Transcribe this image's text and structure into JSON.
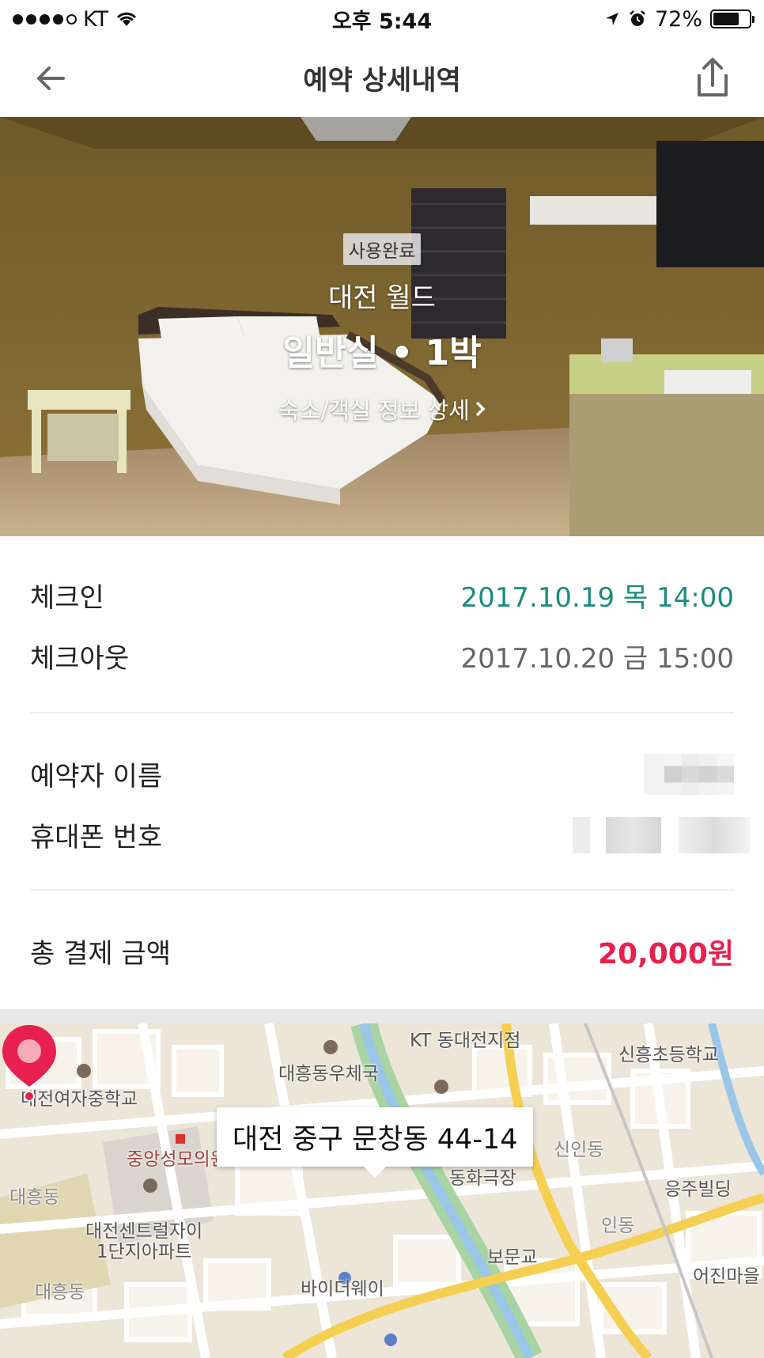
{
  "status_bar": {
    "carrier": "KT",
    "time": "오후 5:44",
    "battery": "72%",
    "battery_level": 0.72
  },
  "nav": {
    "title": "예약 상세내역"
  },
  "hero": {
    "badge": "사용완료",
    "hotel_name": "대전 월드",
    "room_info": "일반실 • 1박",
    "detail_link": "숙소/객실 정보 상세"
  },
  "stay": {
    "checkin_label": "체크인",
    "checkin_value": "2017.10.19 목 14:00",
    "checkout_label": "체크아웃",
    "checkout_value": "2017.10.20 금 15:00"
  },
  "guest": {
    "name_label": "예약자 이름",
    "phone_label": "휴대폰 번호"
  },
  "payment": {
    "total_label": "총 결제 금액",
    "total_value": "20,000원"
  },
  "map": {
    "address": "대전 중구 문창동 44-14",
    "labels": {
      "kt": "KT 동대전지점",
      "school1": "신흥초등학교",
      "post": "대흥동우체국",
      "school2": "대전여자중학교",
      "church": "중앙성모의원",
      "shinin": "신인동",
      "daeheung": "대흥동",
      "theater": "동화극장",
      "eungju": "응주빌딩",
      "apt": "대전센트럴자이\n1단지아파트",
      "indong": "인동",
      "bomun": "보문교",
      "daeheung2": "대흥동",
      "buyer": "바이더웨이",
      "eojin": "어진마을"
    }
  },
  "colors": {
    "teal": "#1b8c7d",
    "accent_red": "#e8204f"
  }
}
